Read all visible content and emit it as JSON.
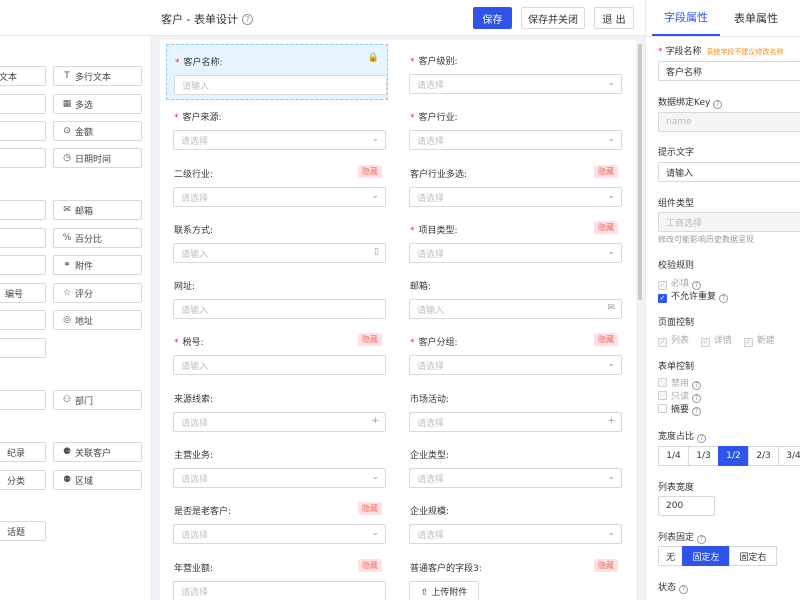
{
  "header": {
    "title": "客户 - 表单设计",
    "help_icon": "?",
    "save": "保存",
    "save_close": "保存并关闭",
    "exit": "退 出"
  },
  "left": {
    "icons": [
      "T",
      "▦",
      "⊙",
      "◷",
      "✉",
      "%",
      "⚭",
      "☆",
      "◎",
      "⚇",
      "⚈",
      "⚉"
    ],
    "labels": [
      "文本",
      "多行文本",
      "多选",
      "金额",
      "日期时间",
      "邮箱",
      "百分比",
      "附件",
      "编号",
      "评分",
      "地址",
      "部门",
      "纪录",
      "关联客户",
      "分类",
      "区域",
      "话题"
    ]
  },
  "canvas": {
    "hidden": "隐藏",
    "fields": [
      {
        "label": "客户名称:",
        "ph": "请输入",
        "req": true,
        "lock": "🔒"
      },
      {
        "label": "客户级别:",
        "ph": "请选择",
        "req": true,
        "suf": "⌄"
      },
      {
        "label": "客户来源:",
        "ph": "请选择",
        "req": true,
        "suf": "⌄"
      },
      {
        "label": "客户行业:",
        "ph": "请选择",
        "req": true,
        "suf": "⌄"
      },
      {
        "label": "二级行业:",
        "ph": "请选择",
        "suf": "⌄",
        "hid": true
      },
      {
        "label": "客户行业多选:",
        "ph": "请选择",
        "suf": "⌄",
        "hid": true
      },
      {
        "label": "联系方式:",
        "ph": "请输入",
        "suf": "▯"
      },
      {
        "label": "项目类型:",
        "ph": "请选择",
        "req": true,
        "suf": "⌄",
        "hid": true
      },
      {
        "label": "网址:",
        "ph": "请输入"
      },
      {
        "label": "邮箱:",
        "ph": "请输入",
        "suf": "✉"
      },
      {
        "label": "税号:",
        "ph": "请输入",
        "req": true,
        "hid": true
      },
      {
        "label": "客户分组:",
        "ph": "请选择",
        "req": true,
        "suf": "⌄",
        "hid": true
      },
      {
        "label": "来源线索:",
        "ph": "请选择",
        "suf": "+"
      },
      {
        "label": "市场活动:",
        "ph": "请选择",
        "suf": "+"
      },
      {
        "label": "主营业务:",
        "ph": "请选择",
        "suf": "⌄"
      },
      {
        "label": "企业类型:",
        "ph": "请选择",
        "suf": "⌄"
      },
      {
        "label": "是否是老客户:",
        "ph": "请选择",
        "suf": "⌄",
        "hid": true
      },
      {
        "label": "企业规模:",
        "ph": "请选择",
        "suf": "⌄"
      },
      {
        "label": "年营业额:",
        "ph": "请选择",
        "hid": true
      },
      {
        "label": "普通客户的字段3:",
        "upload": "⇧ 上传附件",
        "hid": true
      }
    ]
  },
  "right": {
    "tabs": [
      "字段属性",
      "表单属性"
    ],
    "field_name_label": "字段名称",
    "sys_note": "系统字段不建议修改名称",
    "field_name_value": "客户名称",
    "key_label": "数据绑定Key",
    "key_value": "name",
    "hint_label": "提示文字",
    "hint_value": "请输入",
    "type_label": "组件类型",
    "type_value": "工商选择",
    "type_note": "修改可能影响历史数据呈现",
    "validate_label": "校验规则",
    "required": "必填",
    "no_dup": "不允许重复",
    "page_ctrl_label": "页面控制",
    "page_opts": [
      "列表",
      "详情",
      "新建"
    ],
    "form_ctrl_label": "表单控制",
    "form_opts": [
      "禁用",
      "只读",
      "摘要"
    ],
    "width_label": "宽度占比",
    "width_opts": [
      "1/4",
      "1/3",
      "1/2",
      "2/3",
      "3/4"
    ],
    "width_selected": "1/2",
    "list_width_label": "列表宽度",
    "list_width_value": "200",
    "list_fixed_label": "列表固定",
    "list_fixed_opts": [
      "无",
      "固定左",
      "固定右"
    ],
    "list_fixed_selected": "固定左",
    "status_label": "状态"
  }
}
